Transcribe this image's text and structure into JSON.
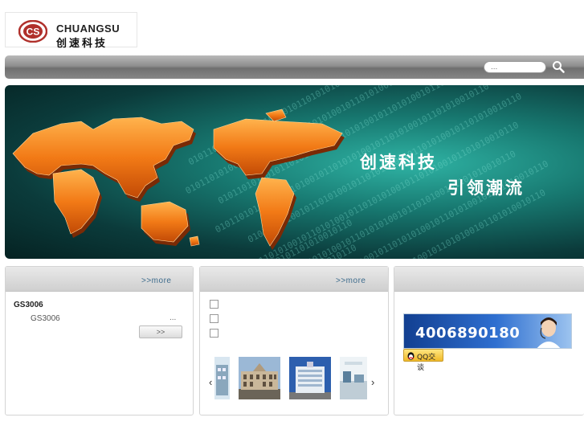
{
  "logo": {
    "brand_en": "CHUANGSU",
    "brand_cn": "创速科技",
    "mark_text": "CS"
  },
  "search": {
    "placeholder": "..."
  },
  "banner": {
    "line1": "创速科技",
    "line2": "引领潮流",
    "binary_text": "0101101010010110101001011010101001011010100101101010010110"
  },
  "panels": {
    "products": {
      "more_label": ">>more",
      "item_title": "GS3006",
      "item_sub": "GS3006",
      "item_ellipsis": "...",
      "detail_button": ">>"
    },
    "cases": {
      "more_label": ">>more",
      "prev_arrow": "‹",
      "next_arrow": "›"
    },
    "contact": {
      "phone": "4006890180",
      "qq_label": "QQ交谈"
    }
  },
  "colors": {
    "more_link": "#3d6b8c",
    "banner_teal": "#17776f",
    "map_orange": "#f27a16",
    "contact_blue": "#2e6fd0",
    "qq_yellow": "#f0b928"
  }
}
